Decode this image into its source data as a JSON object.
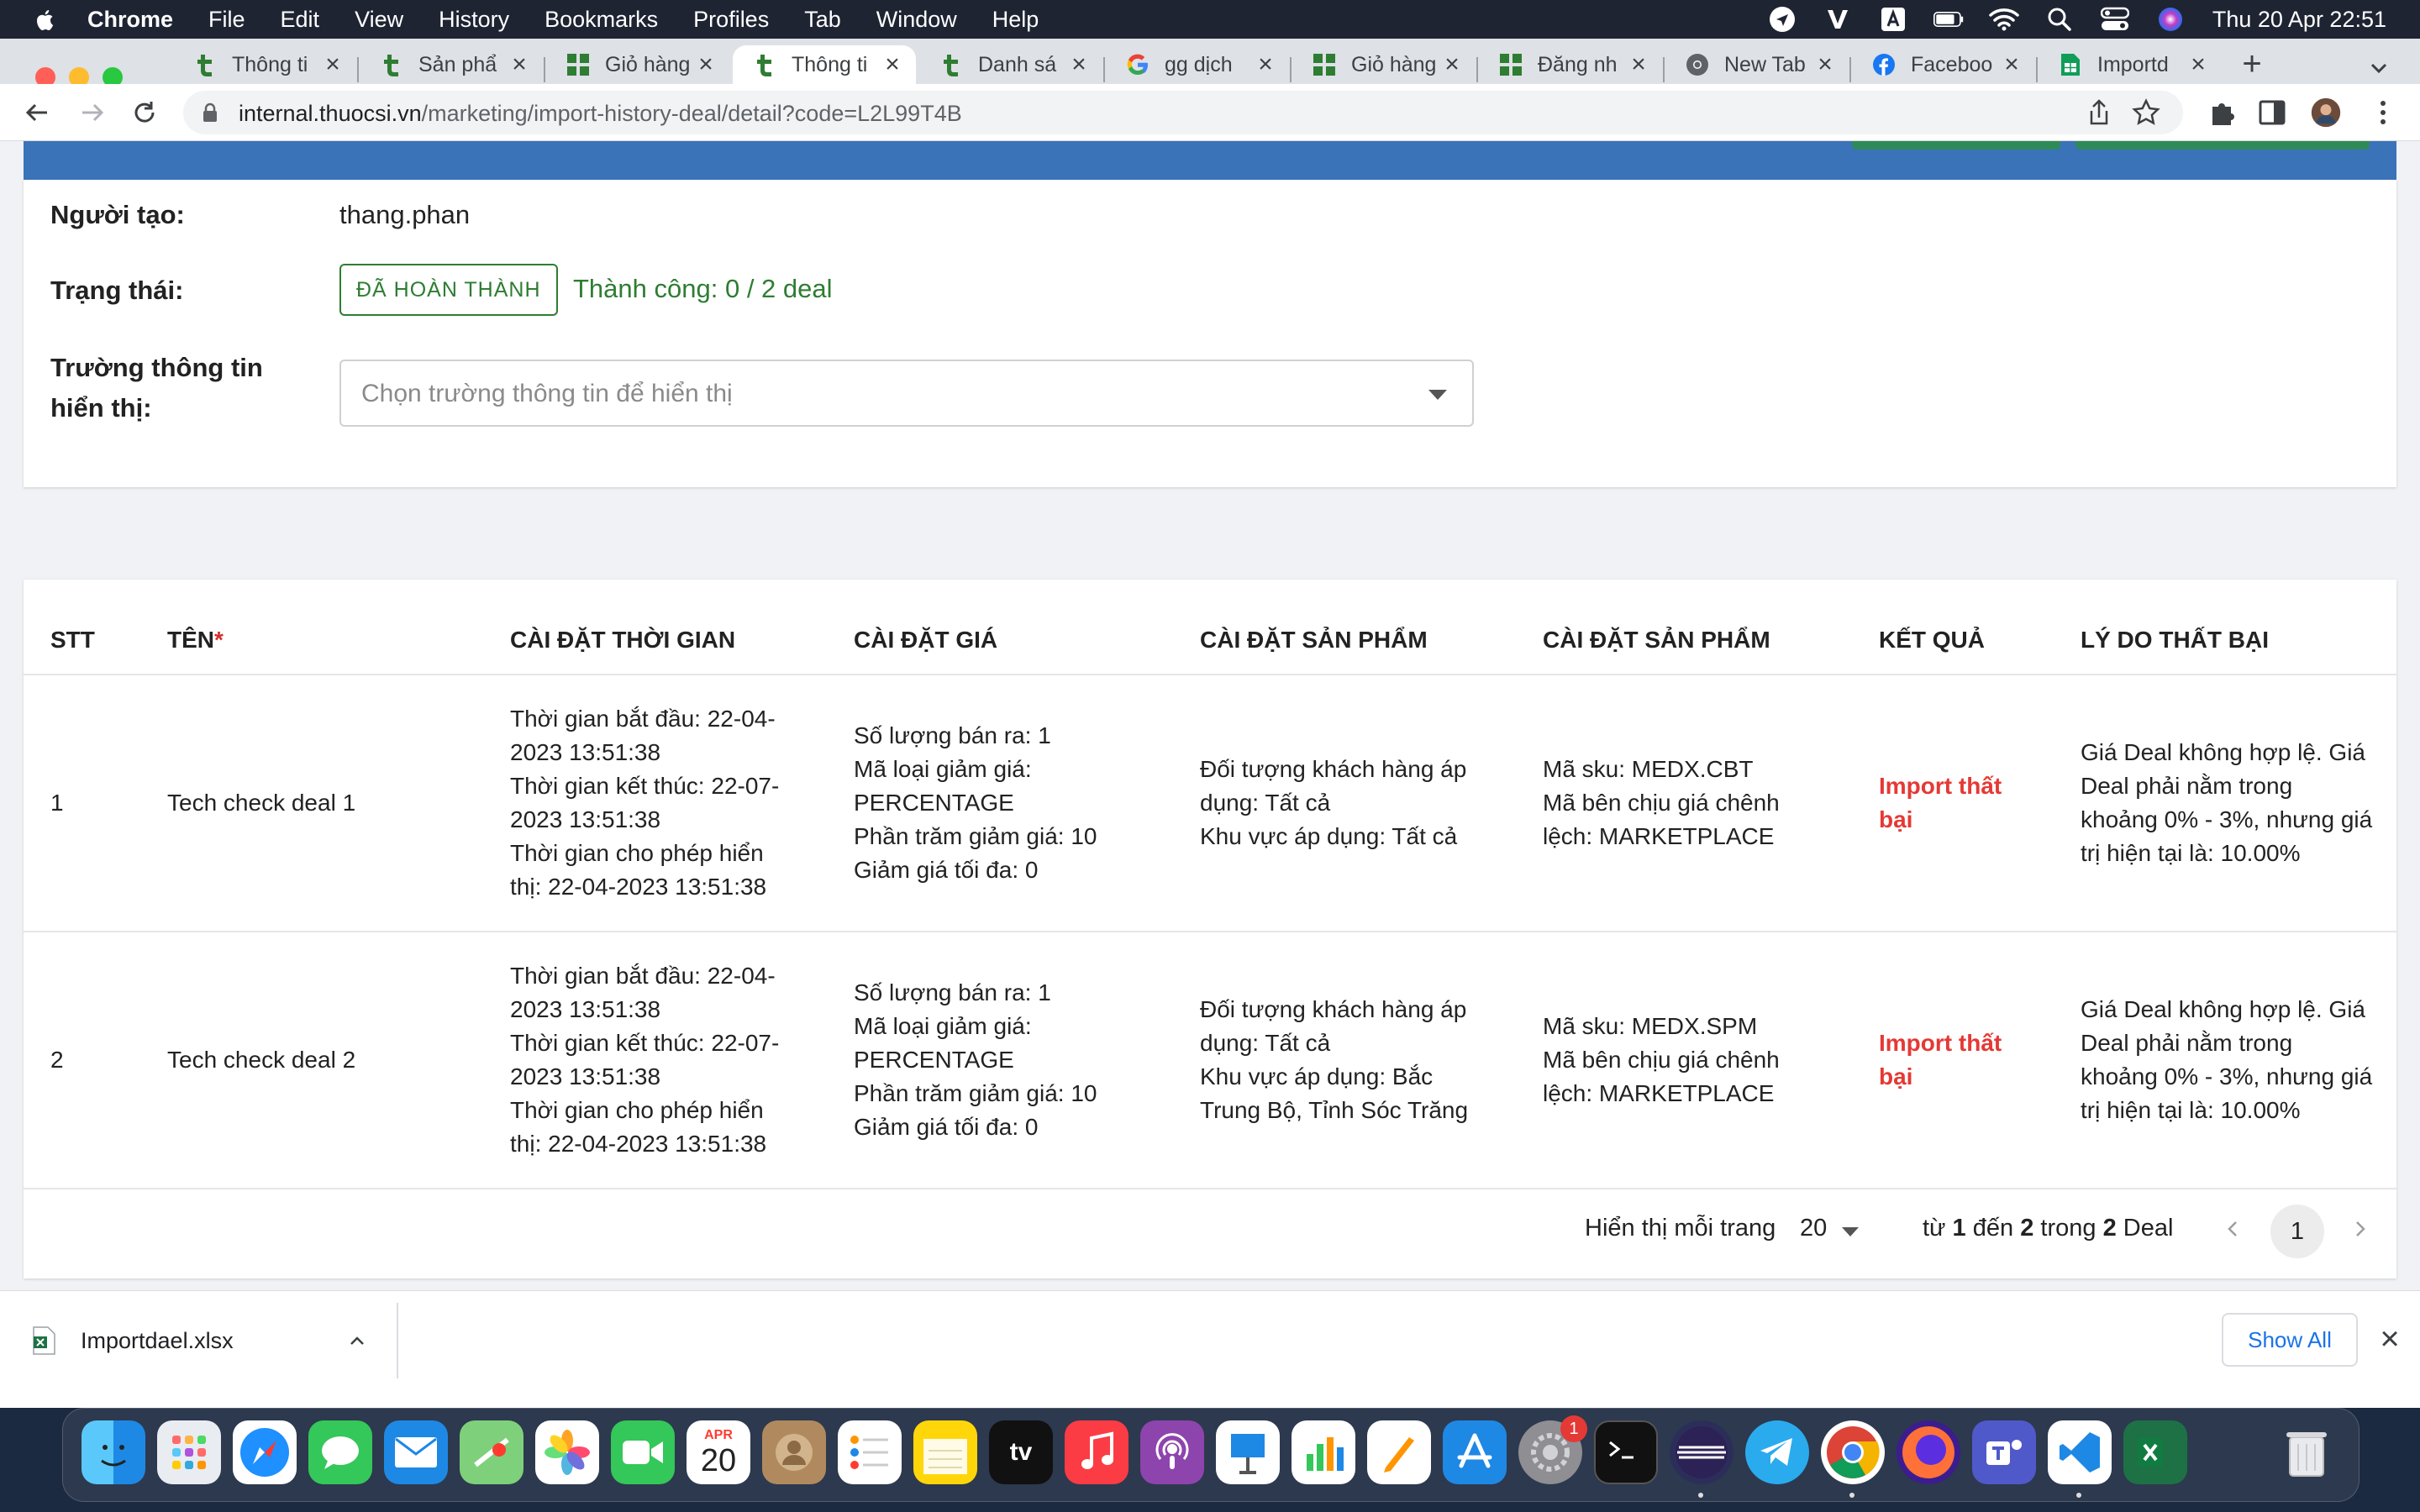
{
  "menubar": {
    "app": "Chrome",
    "items": [
      "File",
      "Edit",
      "View",
      "History",
      "Bookmarks",
      "Profiles",
      "Tab",
      "Window",
      "Help"
    ],
    "clock": "Thu 20 Apr  22:51"
  },
  "tabs": [
    {
      "title": "Thông ti",
      "icon": "thuocsi-t-icon"
    },
    {
      "title": "Sản phẩ",
      "icon": "thuocsi-t-icon"
    },
    {
      "title": "Giỏ hàng",
      "icon": "grid-icon"
    },
    {
      "title": "Thông ti",
      "icon": "thuocsi-t-icon",
      "active": true
    },
    {
      "title": "Danh sá",
      "icon": "thuocsi-t-icon"
    },
    {
      "title": "gg dịch",
      "icon": "google-icon"
    },
    {
      "title": "Giỏ hàng",
      "icon": "grid-icon"
    },
    {
      "title": "Đăng nh",
      "icon": "grid-icon"
    },
    {
      "title": "New Tab",
      "icon": "chrome-icon"
    },
    {
      "title": "Faceboo",
      "icon": "facebook-icon"
    },
    {
      "title": "Importd",
      "icon": "sheets-icon"
    }
  ],
  "address": {
    "domain": "internal.thuocsi.vn",
    "path": "/marketing/import-history-deal/detail?code=L2L99T4B"
  },
  "info": {
    "creator_label": "Người tạo:",
    "creator": "thang.phan",
    "status_label": "Trạng thái:",
    "status_badge": "ĐÃ HOÀN THÀNH",
    "success_text": "Thành công: 0 / 2 deal",
    "field_label_1": "Trường thông tin",
    "field_label_2": "hiển thị:",
    "field_placeholder": "Chọn trường thông tin để hiển thị"
  },
  "table": {
    "headers": {
      "stt": "STT",
      "name": "TÊN",
      "name_required": "*",
      "time": "CÀI ĐẶT THỜI GIAN",
      "price": "CÀI ĐẶT GIÁ",
      "product1": "CÀI ĐẶT SẢN PHẨM",
      "product2": "CÀI ĐẶT SẢN PHẨM",
      "result": "KẾT QUẢ",
      "reason": "LÝ DO THẤT BẠI"
    },
    "rows": [
      {
        "stt": "1",
        "name": "Tech check deal 1",
        "time": [
          "Thời gian bắt đầu: 22-04-",
          "2023 13:51:38",
          "Thời gian kết thúc: 22-07-",
          "2023 13:51:38",
          "Thời gian cho phép hiển",
          "thị: 22-04-2023 13:51:38"
        ],
        "price": [
          "Số lượng bán ra: 1",
          "Mã loại giảm giá:",
          "PERCENTAGE",
          "Phần trăm giảm giá: 10",
          "Giảm giá tối đa: 0"
        ],
        "product1": [
          "Đối tượng khách hàng áp",
          "dụng: Tất cả",
          "Khu vực áp dụng: Tất cả"
        ],
        "product2": [
          "Mã sku: MEDX.CBT",
          "Mã bên chịu giá chênh",
          "lệch: MARKETPLACE"
        ],
        "result": [
          "Import thất",
          "bại"
        ],
        "reason": [
          "Giá Deal không hợp lệ. Giá",
          "Deal phải nằm trong",
          "khoảng 0% - 3%, nhưng giá",
          "trị hiện tại là: 10.00%"
        ]
      },
      {
        "stt": "2",
        "name": "Tech check deal 2",
        "time": [
          "Thời gian bắt đầu: 22-04-",
          "2023 13:51:38",
          "Thời gian kết thúc: 22-07-",
          "2023 13:51:38",
          "Thời gian cho phép hiển",
          "thị: 22-04-2023 13:51:38"
        ],
        "price": [
          "Số lượng bán ra: 1",
          "Mã loại giảm giá:",
          "PERCENTAGE",
          "Phần trăm giảm giá: 10",
          "Giảm giá tối đa: 0"
        ],
        "product1": [
          "Đối tượng khách hàng áp",
          "dụng: Tất cả",
          "Khu vực áp dụng: Bắc",
          "Trung Bộ, Tỉnh Sóc Trăng"
        ],
        "product2": [
          "Mã sku: MEDX.SPM",
          "Mã bên chịu giá chênh",
          "lệch: MARKETPLACE"
        ],
        "result": [
          "Import thất",
          "bại"
        ],
        "reason": [
          "Giá Deal không hợp lệ. Giá",
          "Deal phải nằm trong",
          "khoảng 0% - 3%, nhưng giá",
          "trị hiện tại là: 10.00%"
        ]
      }
    ]
  },
  "pagination": {
    "per_page_label": "Hiển thị mỗi trang",
    "per_page": "20",
    "range_from_word": "từ",
    "range_from": "1",
    "range_to_word": "đến",
    "range_to": "2",
    "range_of_word": "trong",
    "total": "2",
    "unit": "Deal",
    "current_page": "1"
  },
  "downloads": {
    "file": "Importdael.xlsx",
    "show_all": "Show All"
  },
  "dock": {
    "calendar_month": "APR",
    "calendar_day": "20",
    "tv_label": "tv",
    "settings_badge": "1"
  },
  "colors": {
    "header_band": "#3b73b9",
    "success": "#2e7d32",
    "fail": "#e53935",
    "link": "#1a73e8"
  }
}
